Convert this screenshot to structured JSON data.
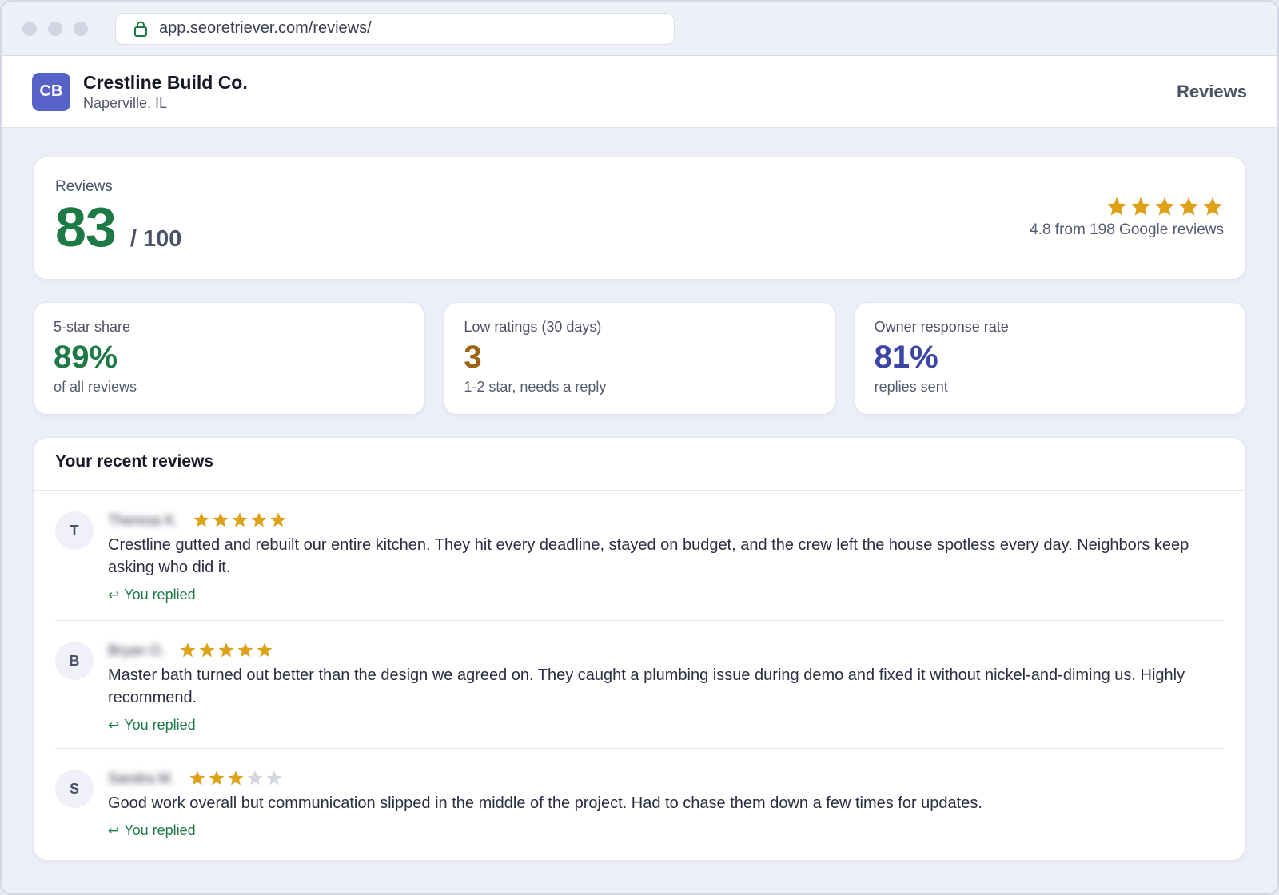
{
  "browser": {
    "url": "app.seoretriever.com/reviews/"
  },
  "header": {
    "logo_text": "CB",
    "business_name": "Crestline Build Co.",
    "location": "Naperville, IL",
    "nav_label": "Reviews"
  },
  "score": {
    "label": "Reviews",
    "value": "83",
    "max": "/ 100",
    "google_rating": 4.8,
    "rating_text": "4.8 from 198 Google reviews",
    "stars_filled": 5
  },
  "stats": [
    {
      "label": "5-star share",
      "value": "89%",
      "sub": "of all reviews",
      "color": "#1d7a46"
    },
    {
      "label": "Low ratings (30 days)",
      "value": "3",
      "sub": "1-2 star, needs a reply",
      "color": "#9a6410"
    },
    {
      "label": "Owner response rate",
      "value": "81%",
      "sub": "replies sent",
      "color": "#3c44a6"
    }
  ],
  "recent": {
    "title": "Your recent reviews",
    "items": [
      {
        "initial": "T",
        "name": "Theresa K.",
        "stars": 5,
        "text": "Crestline gutted and rebuilt our entire kitchen. They hit every deadline, stayed on budget, and the crew left the house spotless every day. Neighbors keep asking who did it.",
        "reply_status": "You replied"
      },
      {
        "initial": "B",
        "name": "Bryan O.",
        "stars": 5,
        "text": "Master bath turned out better than the design we agreed on. They caught a plumbing issue during demo and fixed it without nickel-and-diming us. Highly recommend.",
        "reply_status": "You replied"
      },
      {
        "initial": "S",
        "name": "Sandra M.",
        "stars": 3,
        "text": "Good work overall but communication slipped in the middle of the project. Had to chase them down a few times for updates.",
        "reply_status": "You replied"
      }
    ]
  },
  "colors": {
    "star_filled": "#dba21a",
    "star_empty": "#d4d6e2",
    "accent_green": "#1d7a46",
    "logo_bg": "#5662c8"
  }
}
